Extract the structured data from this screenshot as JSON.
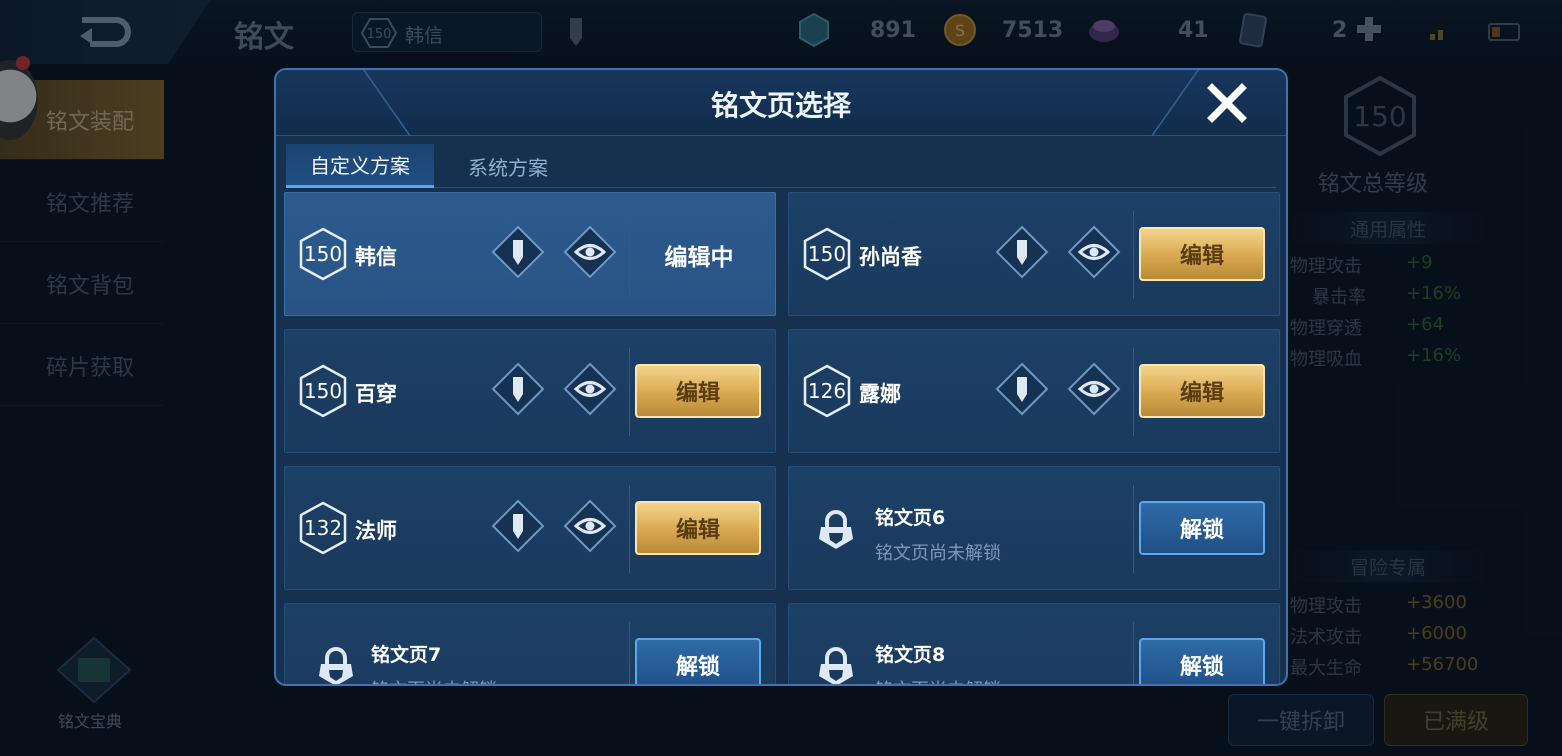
{
  "topbar": {
    "title": "铭文",
    "hero_level": "150",
    "hero_name": "韩信",
    "resources": [
      {
        "icon": "blue-crystal-icon",
        "value": "891"
      },
      {
        "icon": "gold-coin-icon",
        "value": "7513"
      },
      {
        "icon": "purple-gem-icon",
        "value": "41"
      },
      {
        "icon": "card-icon",
        "value": "2"
      }
    ]
  },
  "sidebar": {
    "items": [
      {
        "label": "铭文装配"
      },
      {
        "label": "铭文推荐"
      },
      {
        "label": "铭文背包"
      },
      {
        "label": "碎片获取"
      }
    ],
    "codex_label": "铭文宝典"
  },
  "right_panel": {
    "total_level": "150",
    "total_level_label": "铭文总等级",
    "general_header": "通用属性",
    "general_attrs": [
      {
        "name": "物理攻击",
        "value": "+9"
      },
      {
        "name": "暴击率",
        "value": "+16%"
      },
      {
        "name": "物理穿透",
        "value": "+64"
      },
      {
        "name": "物理吸血",
        "value": "+16%"
      }
    ],
    "adventure_header": "冒险专属",
    "adventure_attrs": [
      {
        "name": "物理攻击",
        "value": "+3600"
      },
      {
        "name": "法术攻击",
        "value": "+6000"
      },
      {
        "name": "最大生命",
        "value": "+56700"
      }
    ],
    "unload_button": "一键拆卸",
    "maxed_button": "已满级"
  },
  "modal": {
    "title": "铭文页选择",
    "tabs": [
      {
        "label": "自定义方案"
      },
      {
        "label": "系统方案"
      }
    ],
    "pages": [
      {
        "level": "150",
        "name": "韩信",
        "status": "编辑中"
      },
      {
        "level": "150",
        "name": "孙尚香",
        "button": "编辑"
      },
      {
        "level": "150",
        "name": "百穿",
        "button": "编辑"
      },
      {
        "level": "126",
        "name": "露娜",
        "button": "编辑"
      },
      {
        "level": "132",
        "name": "法师",
        "button": "编辑"
      },
      {
        "name": "铭文页6",
        "sub": "铭文页尚未解锁",
        "button": "解锁"
      },
      {
        "name": "铭文页7",
        "sub": "铭文页尚未解锁",
        "button": "解锁"
      },
      {
        "name": "铭文页8",
        "sub": "铭文页尚未解锁",
        "button": "解锁"
      }
    ]
  },
  "colors": {
    "gold_button": "#d8a850",
    "blue_button": "#1f4f85",
    "modal_bg": "#16304f",
    "general_value": "#3b8a3b",
    "adventure_value": "#a37a2e"
  }
}
